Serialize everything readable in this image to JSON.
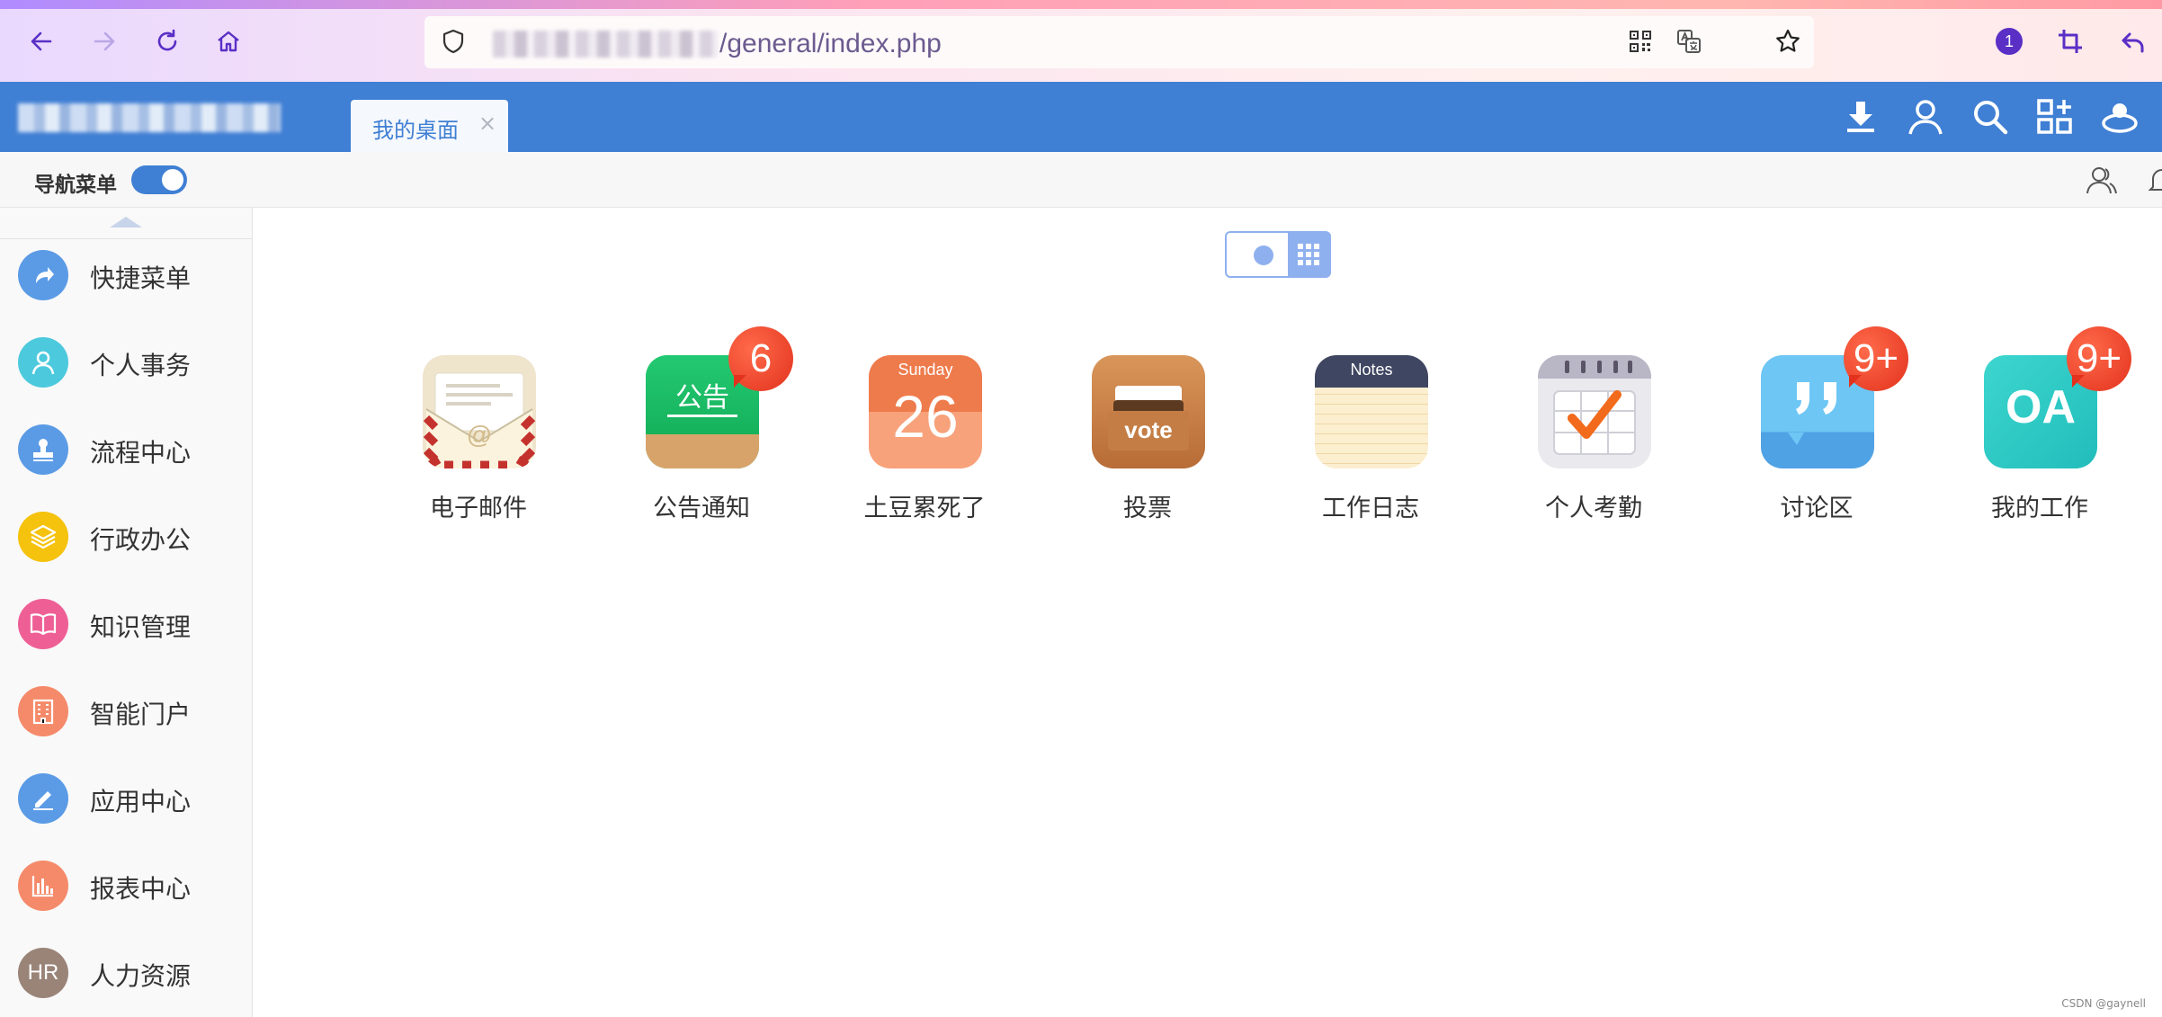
{
  "browser": {
    "url_text": "/general/index.php",
    "notification_count": "1"
  },
  "header": {
    "tabs": [
      {
        "label": "我的桌面",
        "close": "×"
      }
    ]
  },
  "toolbar": {
    "nav_menu_label": "导航菜单"
  },
  "sidebar": {
    "items": [
      {
        "label": "快捷菜单",
        "icon": "shortcut-icon",
        "color": "#5b9be6"
      },
      {
        "label": "个人事务",
        "icon": "user-icon",
        "color": "#4cc9dd"
      },
      {
        "label": "流程中心",
        "icon": "stamp-icon",
        "color": "#5b9be6"
      },
      {
        "label": "行政办公",
        "icon": "layers-icon",
        "color": "#f5c20d"
      },
      {
        "label": "知识管理",
        "icon": "book-icon",
        "color": "#ee5f95"
      },
      {
        "label": "智能门户",
        "icon": "building-icon",
        "color": "#f58a6a"
      },
      {
        "label": "应用中心",
        "icon": "edit-icon",
        "color": "#5b9be6"
      },
      {
        "label": "报表中心",
        "icon": "chart-icon",
        "color": "#f58a6a"
      },
      {
        "label": "人力资源",
        "icon": "hr-icon",
        "color": "#9a8478",
        "text": "HR"
      }
    ]
  },
  "apps": [
    {
      "label": "电子邮件",
      "icon": "mail-icon",
      "badge": ""
    },
    {
      "label": "公告通知",
      "icon": "notice-icon",
      "badge": "6",
      "tile_text": "公告"
    },
    {
      "label": "土豆累死了",
      "icon": "calendar-icon",
      "badge": "",
      "tile_day": "Sunday",
      "tile_date": "26"
    },
    {
      "label": "投票",
      "icon": "vote-icon",
      "badge": "",
      "tile_text": "vote"
    },
    {
      "label": "工作日志",
      "icon": "notes-icon",
      "badge": "",
      "tile_text": "Notes"
    },
    {
      "label": "个人考勤",
      "icon": "attendance-icon",
      "badge": ""
    },
    {
      "label": "讨论区",
      "icon": "discussion-icon",
      "badge": "9+"
    },
    {
      "label": "我的工作",
      "icon": "oa-icon",
      "badge": "9+",
      "tile_text": "OA"
    }
  ],
  "footer": {
    "text": "CSDN @gaynell"
  },
  "colors": {
    "header_blue": "#3f7fd4",
    "toggle_blue": "#3f7fd4",
    "badge_red": "#e2321d"
  }
}
